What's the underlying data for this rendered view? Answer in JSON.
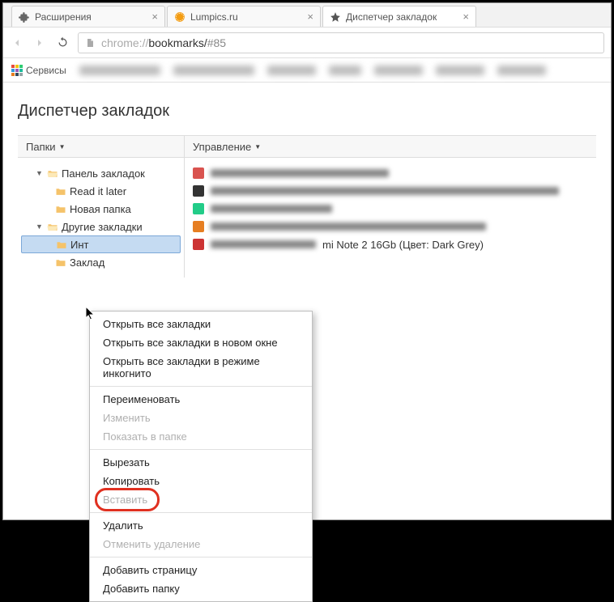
{
  "tabs": [
    {
      "title": "Расширения",
      "icon": "puzzle"
    },
    {
      "title": "Lumpics.ru",
      "icon": "orange"
    },
    {
      "title": "Диспетчер закладок",
      "icon": "star",
      "active": true
    }
  ],
  "address": {
    "proto": "chrome://",
    "path": "bookmarks/",
    "frag": "#85"
  },
  "bookmarks_bar": {
    "services_label": "Сервисы"
  },
  "page": {
    "title": "Диспетчер закладок",
    "folders_header": "Папки",
    "manage_header": "Управление",
    "tree": {
      "bookmark_bar": "Панель закладок",
      "read_later": "Read it later",
      "new_folder": "Новая папка",
      "other_bookmarks": "Другие закладки",
      "selected": "Инт",
      "bookmarks_sub": "Заклад"
    },
    "list": {
      "item5": "mi Note 2 16Gb (Цвет: Dark Grey)"
    }
  },
  "context_menu": {
    "open_all": "Открыть все закладки",
    "open_all_new": "Открыть все закладки в новом окне",
    "open_all_incognito": "Открыть все закладки в режиме инкогнито",
    "rename": "Переименовать",
    "edit": "Изменить",
    "show_in_folder": "Показать в папке",
    "cut": "Вырезать",
    "copy": "Копировать",
    "paste": "Вставить",
    "delete": "Удалить",
    "undo_delete": "Отменить удаление",
    "add_page": "Добавить страницу",
    "add_folder": "Добавить папку"
  }
}
